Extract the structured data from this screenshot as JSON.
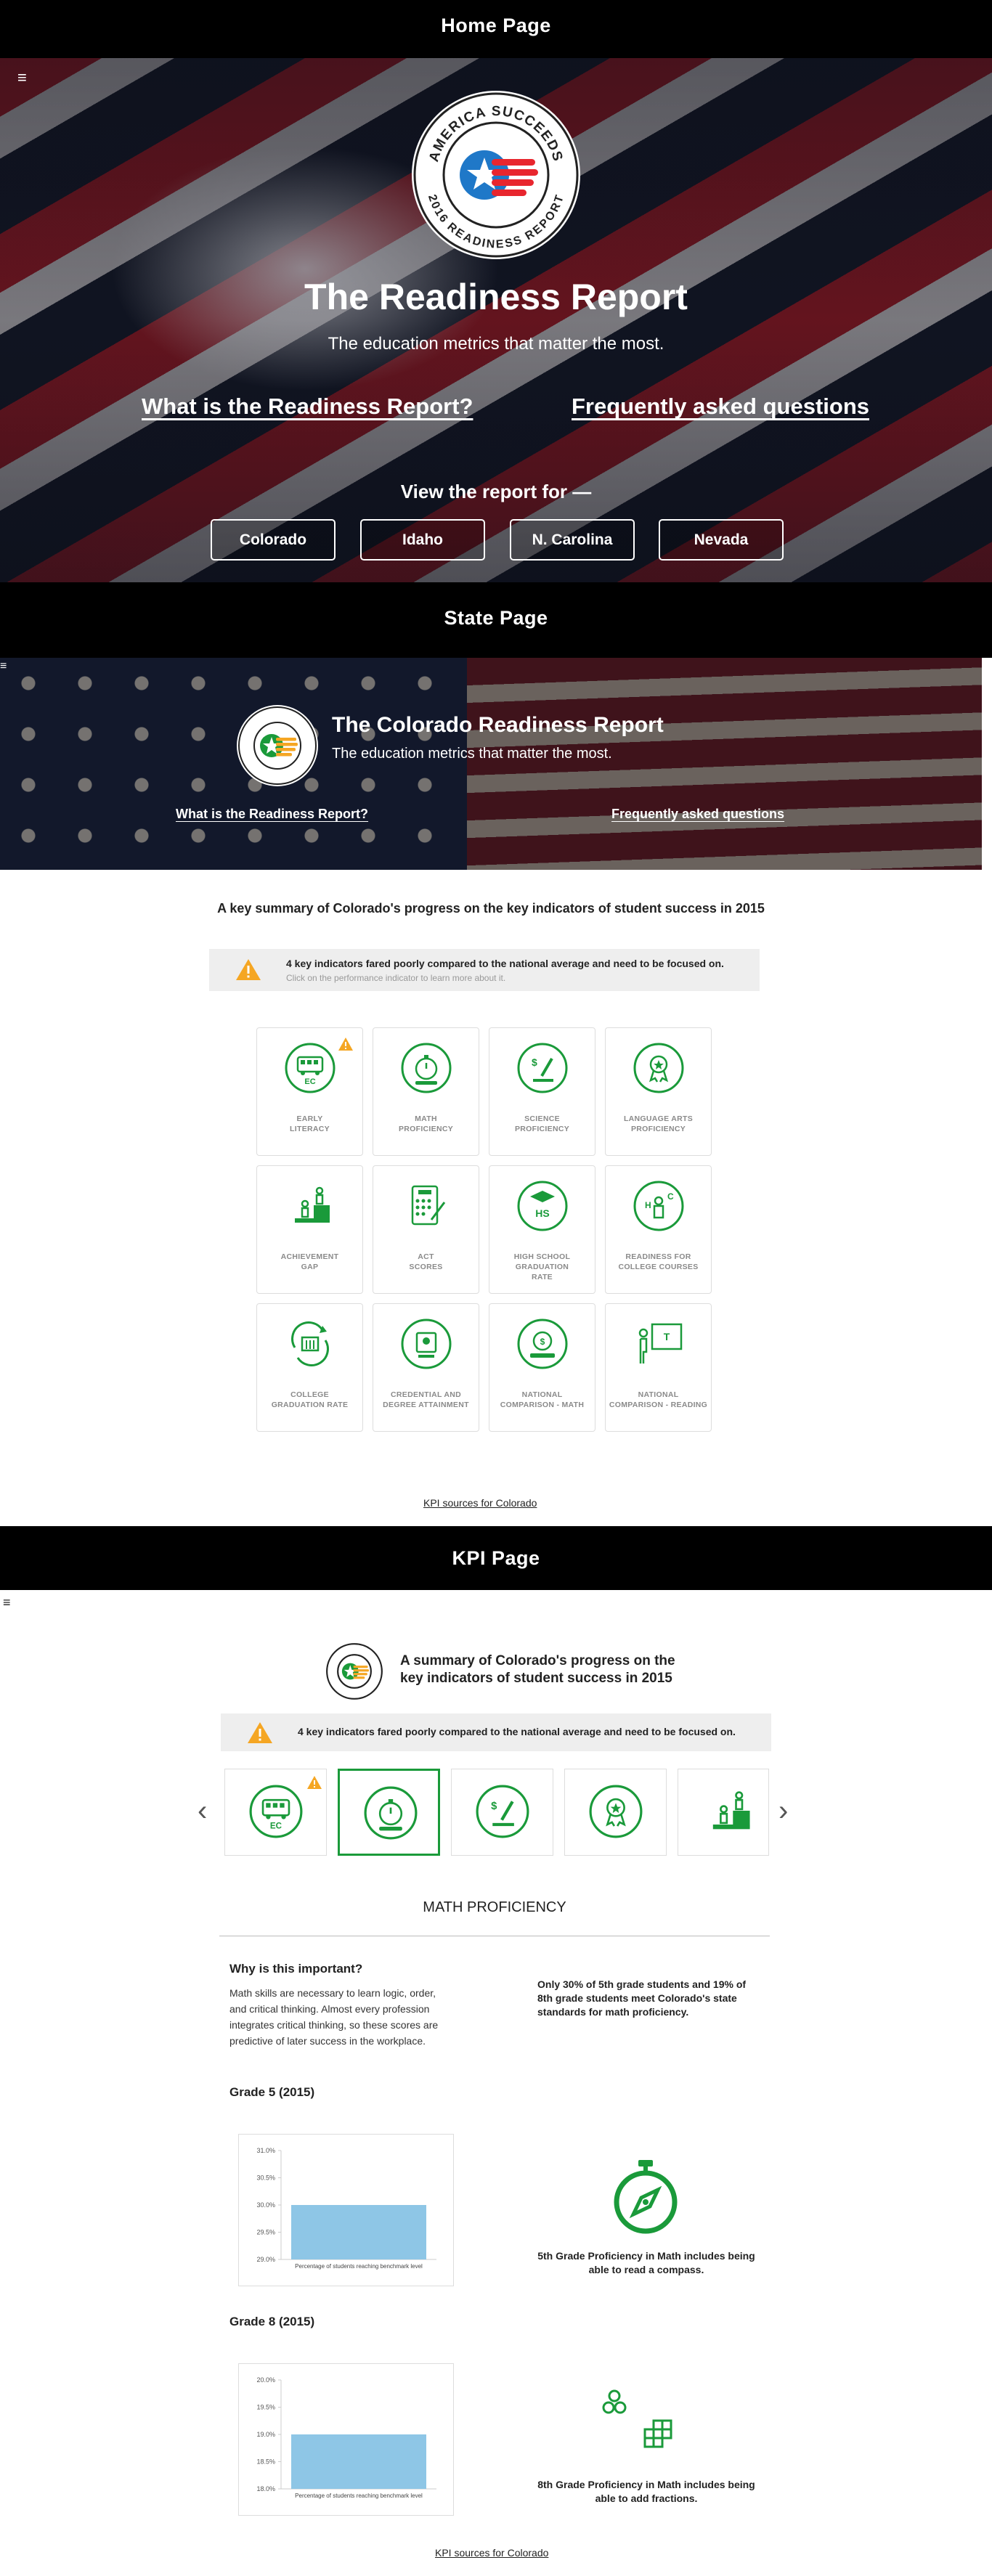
{
  "sections": {
    "home": "Home Page",
    "state": "State Page",
    "kpi": "KPI Page"
  },
  "home": {
    "seal_text_top": "AMERICA SUCCEEDS",
    "seal_text_bottom": "2016 READINESS REPORT",
    "title": "The Readiness Report",
    "subtitle": "The education metrics that matter the most.",
    "link_what": "What is the Readiness Report?",
    "link_faq": "Frequently asked questions",
    "view_for": "View the report for —",
    "states": [
      "Colorado",
      "Idaho",
      "N. Carolina",
      "Nevada"
    ]
  },
  "state": {
    "title": "The Colorado Readiness Report",
    "subtitle": "The education metrics that matter the most.",
    "link_what": "What is the Readiness Report?",
    "link_faq": "Frequently asked questions",
    "summary": "A key summary of Colorado's progress on the key indicators of student success in 2015",
    "alert_main": "4 key indicators fared poorly compared to the national average and need to be focused on.",
    "alert_hint": "Click on the performance indicator to learn more about it.",
    "tiles": [
      {
        "l1": "EARLY",
        "l2": "LITERACY",
        "l3": ""
      },
      {
        "l1": "MATH",
        "l2": "PROFICIENCY",
        "l3": ""
      },
      {
        "l1": "SCIENCE",
        "l2": "PROFICIENCY",
        "l3": ""
      },
      {
        "l1": "LANGUAGE ARTS",
        "l2": "PROFICIENCY",
        "l3": ""
      },
      {
        "l1": "ACHIEVEMENT",
        "l2": "GAP",
        "l3": ""
      },
      {
        "l1": "ACT",
        "l2": "SCORES",
        "l3": ""
      },
      {
        "l1": "HIGH SCHOOL",
        "l2": "GRADUATION",
        "l3": "RATE"
      },
      {
        "l1": "READINESS FOR",
        "l2": "COLLEGE COURSES",
        "l3": ""
      },
      {
        "l1": "COLLEGE",
        "l2": "GRADUATION RATE",
        "l3": ""
      },
      {
        "l1": "CREDENTIAL AND",
        "l2": "DEGREE ATTAINMENT",
        "l3": ""
      },
      {
        "l1": "NATIONAL",
        "l2": "COMPARISON - MATH",
        "l3": ""
      },
      {
        "l1": "NATIONAL",
        "l2": "COMPARISON - READING",
        "l3": ""
      }
    ],
    "kpi_sources": "KPI sources for Colorado"
  },
  "kpi": {
    "title_l1": "A summary of Colorado's progress on the",
    "title_l2": "key indicators of student success in 2015",
    "alert_main": "4 key indicators fared poorly compared to the national average and need to be focused on.",
    "section_title": "MATH PROFICIENCY",
    "why_heading": "Why is this important?",
    "why_text": "Math skills are necessary to learn logic, order, and critical thinking. Almost every profession integrates critical thinking, so these scores are predictive of later success in the workplace.",
    "only_text": "Only 30% of 5th grade students and 19% of 8th grade students meet Colorado's state standards for math proficiency.",
    "grade5_heading": "Grade 5 (2015)",
    "grade8_heading": "Grade 8 (2015)",
    "grade5_caption": "5th Grade Proficiency in Math includes being able to read a compass.",
    "grade8_caption": "8th Grade Proficiency in Math includes being able to add fractions.",
    "kpi_sources": "KPI sources for Colorado",
    "prev_arrow": "‹",
    "next_arrow": "›"
  },
  "chart_data": [
    {
      "type": "bar",
      "title": "",
      "xlabel": "Percentage of students reaching benchmark level",
      "ylabel": "",
      "categories": [
        "Percentage of students reaching benchmark level"
      ],
      "values": [
        30.0
      ],
      "ylim": [
        29.0,
        31.0
      ],
      "yticks": [
        "29.0%",
        "29.5%",
        "30.0%",
        "30.5%",
        "31.0%"
      ],
      "bar_color": "#8ec6e6"
    },
    {
      "type": "bar",
      "title": "",
      "xlabel": "Percentage of students reaching benchmark level",
      "ylabel": "",
      "categories": [
        "Percentage of students reaching benchmark level"
      ],
      "values": [
        19.0
      ],
      "ylim": [
        18.0,
        20.0
      ],
      "yticks": [
        "18.0%",
        "18.5%",
        "19.0%",
        "19.5%",
        "20.0%"
      ],
      "bar_color": "#8ec6e6"
    }
  ],
  "colors": {
    "green": "#1a9a3a",
    "warning": "#f5a623",
    "red": "#e8262e",
    "blue": "#1f78c8"
  },
  "hamburger": "≡"
}
